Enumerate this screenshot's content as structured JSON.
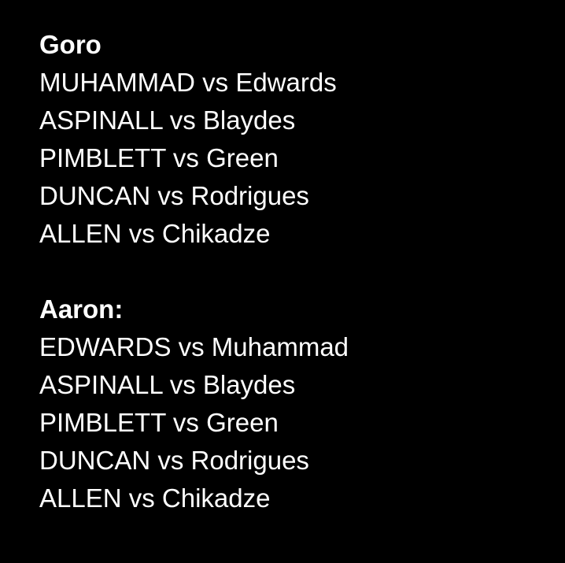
{
  "sections": [
    {
      "heading": "Goro",
      "picks": [
        "MUHAMMAD vs Edwards",
        "ASPINALL vs Blaydes",
        "PIMBLETT vs Green",
        "DUNCAN vs Rodrigues",
        "ALLEN vs Chikadze"
      ]
    },
    {
      "heading": "Aaron:",
      "picks": [
        "EDWARDS vs Muhammad",
        "ASPINALL vs Blaydes",
        "PIMBLETT vs Green",
        "DUNCAN vs Rodrigues",
        "ALLEN vs Chikadze"
      ]
    }
  ],
  "colors": {
    "background": "#000000",
    "text": "#ffffff"
  }
}
